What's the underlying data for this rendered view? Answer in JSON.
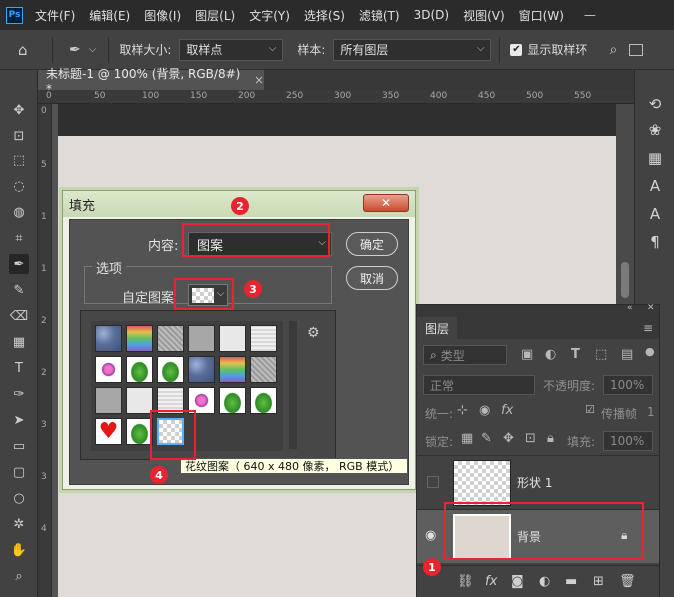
{
  "app": {
    "logo": "Ps"
  },
  "menu": [
    "文件(F)",
    "编辑(E)",
    "图像(I)",
    "图层(L)",
    "文字(Y)",
    "选择(S)",
    "滤镜(T)",
    "3D(D)",
    "视图(V)",
    "窗口(W)"
  ],
  "window_controls": {
    "minimize": "—",
    "maximize": "□",
    "close": "✕"
  },
  "options_bar": {
    "sample_size_label": "取样大小:",
    "sample_size_value": "取样点",
    "sample_label": "样本:",
    "sample_value": "所有图层",
    "show_ring_label": "显示取样环",
    "show_ring_checked": true
  },
  "document_tab": {
    "title": "未标题-1 @ 100% (背景, RGB/8#) *",
    "close": "×"
  },
  "ruler_ticks": [
    "0",
    "50",
    "100",
    "150",
    "200",
    "250",
    "300",
    "350",
    "400",
    "450",
    "500",
    "550"
  ],
  "ruler_left_ticks": [
    "0",
    "5",
    "1",
    "1",
    "2",
    "2",
    "3",
    "3",
    "4"
  ],
  "fill_dialog": {
    "title": "填充",
    "close": "✕",
    "content_label": "内容:",
    "content_value": "图案",
    "ok_label": "确定",
    "cancel_label": "取消",
    "options_label": "选项",
    "custom_pattern_label": "自定图案",
    "tooltip": "花纹图案（ 640 x 480 像素， RGB 模式）"
  },
  "steps": [
    "1",
    "2",
    "3",
    "4"
  ],
  "layers_panel": {
    "tab": "图层",
    "filter_label": "类型",
    "blend_mode": "正常",
    "opacity_label": "不透明度:",
    "opacity_value": "100%",
    "unify_label": "统一:",
    "propagate_label": "传播帧",
    "propagate_value": "1",
    "lock_label": "锁定:",
    "fill_label": "填充:",
    "fill_value": "100%",
    "layers": [
      {
        "name": "形状 1",
        "visible": false
      },
      {
        "name": "背景",
        "visible": true,
        "locked": true
      }
    ]
  },
  "colors": {
    "highlight": "#e8252f",
    "canvas": "#e0dbd6",
    "background_layer": "#ded7d0"
  }
}
